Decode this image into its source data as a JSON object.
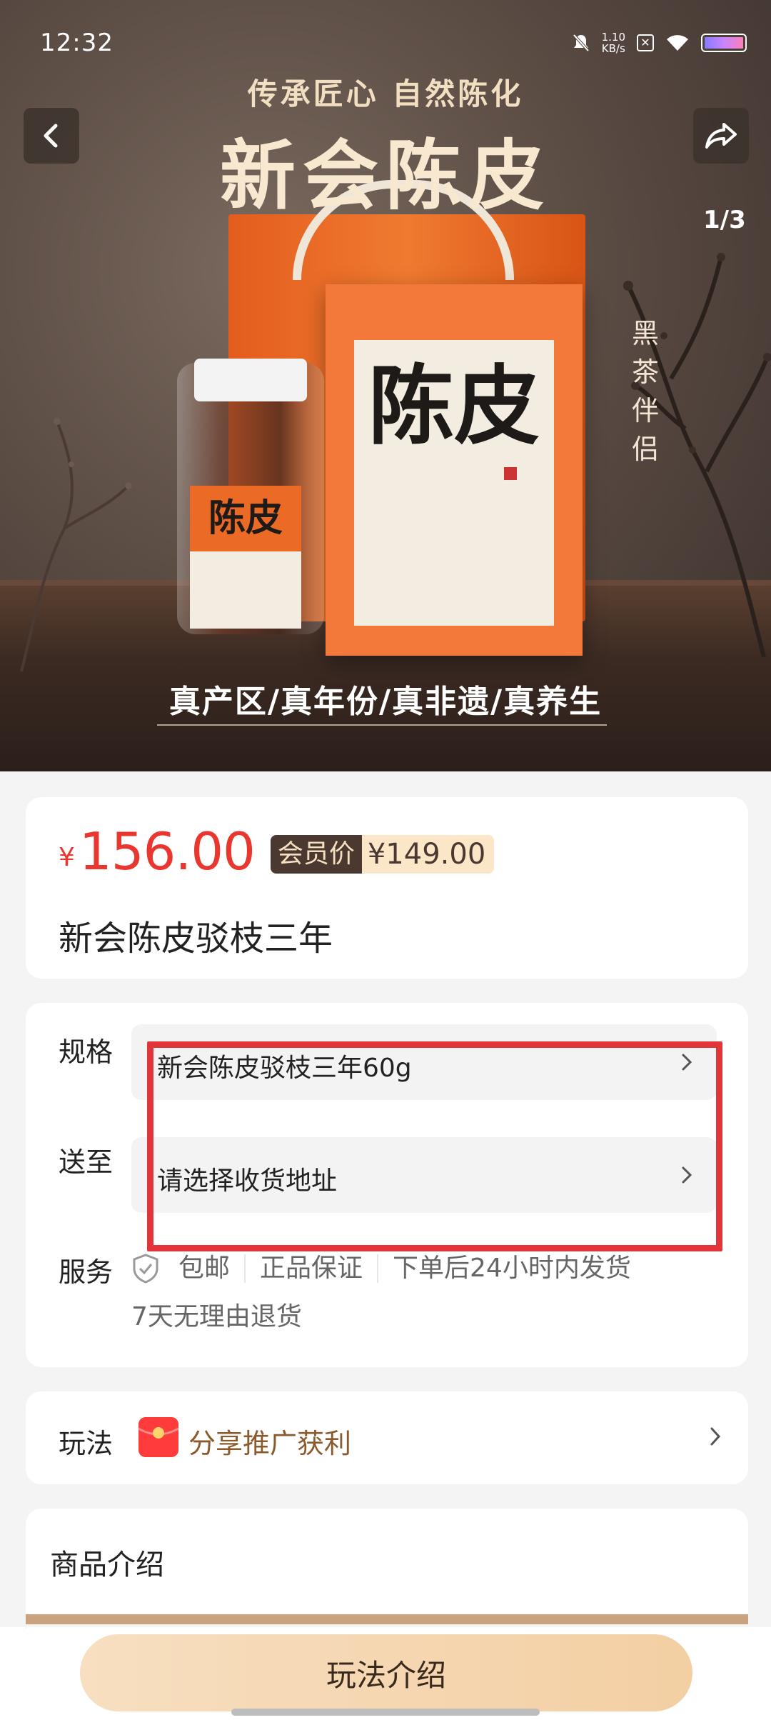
{
  "status_bar": {
    "time": "12:32",
    "net_speed_value": "1.10",
    "net_speed_unit": "KB/s"
  },
  "gallery": {
    "counter": "1/3",
    "slogan_top": "传承匠心 自然陈化",
    "slogan_main": "新会陈皮",
    "slogan_bottom": "真产区/真年份/真非遗/真养生",
    "vertical_text": "黑茶伴侣",
    "box_title": "陈皮",
    "jar_label": "陈皮"
  },
  "product": {
    "currency": "¥",
    "price": "156.00",
    "member_tag": "会员价",
    "member_price": "¥149.00",
    "name": "新会陈皮驳枝三年"
  },
  "spec": {
    "label": "规格",
    "value": "新会陈皮驳枝三年60g"
  },
  "delivery": {
    "label": "送至",
    "value": "请选择收货地址"
  },
  "service": {
    "label": "服务",
    "items": [
      "包邮",
      "正品保证",
      "下单后24小时内发货",
      "7天无理由退货"
    ]
  },
  "play": {
    "label": "玩法",
    "text": "分享推广获利"
  },
  "intro": {
    "title": "商品介绍"
  },
  "bottom": {
    "button": "玩法介绍"
  },
  "colors": {
    "price": "#e9362e",
    "highlight": "#e2353a",
    "button_gradient": [
      "#f7dfc0",
      "#f3cfa3"
    ]
  },
  "icons": [
    "back-icon",
    "share-icon",
    "chevron-right-icon",
    "shield-check-icon",
    "red-packet-icon",
    "mute-icon",
    "wifi-icon",
    "battery-icon"
  ]
}
